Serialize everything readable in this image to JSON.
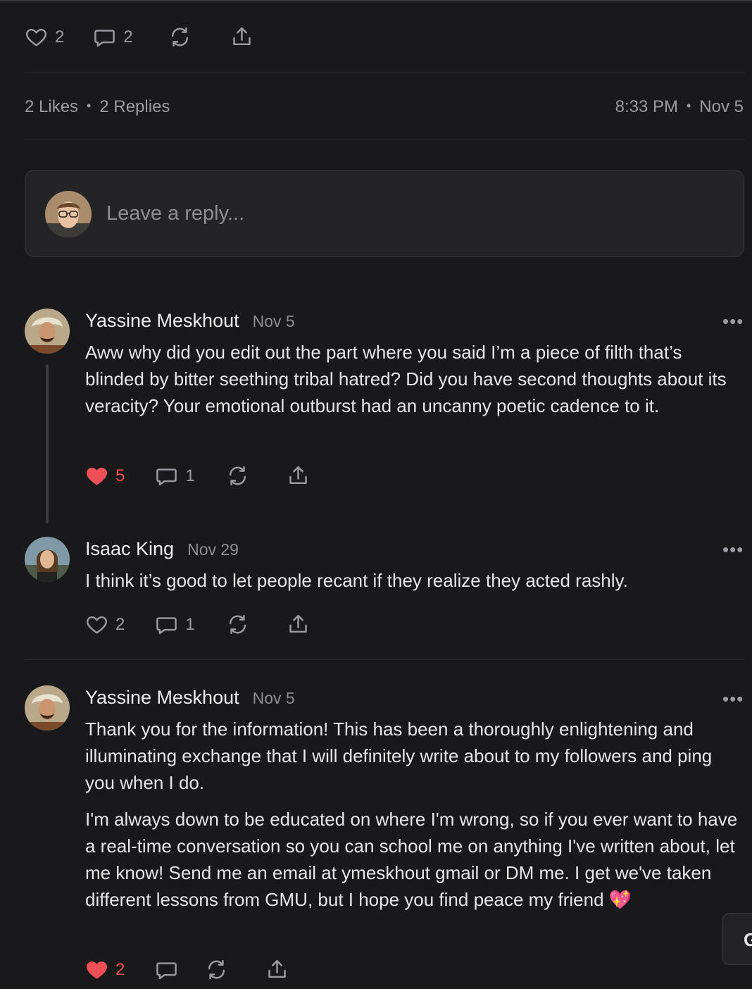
{
  "post_actions": {
    "likes_count": "2",
    "comments_count": "2"
  },
  "post_meta": {
    "likes_label": "2 Likes",
    "replies_label": "2 Replies",
    "time": "8:33 PM",
    "date": "Nov 5"
  },
  "reply_box": {
    "placeholder": "Leave a reply..."
  },
  "comments": [
    {
      "author": "Yassine Meskhout",
      "date": "Nov 5",
      "paragraphs": [
        "Aww why did you edit out the part where you said I’m a piece of filth that’s blinded by bitter seething tribal hatred? Did you have second thoughts about its veracity? Your emotional outburst had an uncanny poetic cadence to it."
      ],
      "likes": "5",
      "liked": true,
      "replies": "1"
    },
    {
      "author": "Isaac King",
      "date": "Nov 29",
      "paragraphs": [
        "I think it’s good to let people recant if they realize they acted rashly."
      ],
      "likes": "2",
      "liked": false,
      "replies": "1"
    },
    {
      "author": "Yassine Meskhout",
      "date": "Nov 5",
      "paragraphs": [
        "Thank you for the information! This has been a thoroughly enlightening and illuminating exchange that I will definitely write about to my followers and ping you when I do.",
        "I'm always down to be educated on where I'm wrong, so if you ever want to have a real-time conversation so you can school me on anything I've written about, let me know! Send me an email at ymeskhout gmail or DM me. I get we've taken different lessons from GMU, but I hope you find peace my friend 💖"
      ],
      "likes": "2",
      "liked": true,
      "replies": ""
    }
  ],
  "more_menu_glyph": "•••",
  "floating_button_label": "G",
  "colors": {
    "background": "#19191b",
    "liked": "#ee4f57",
    "muted": "#9a9aa0"
  },
  "icons": [
    "heart-icon",
    "comment-icon",
    "restack-icon",
    "share-icon",
    "more-icon"
  ]
}
